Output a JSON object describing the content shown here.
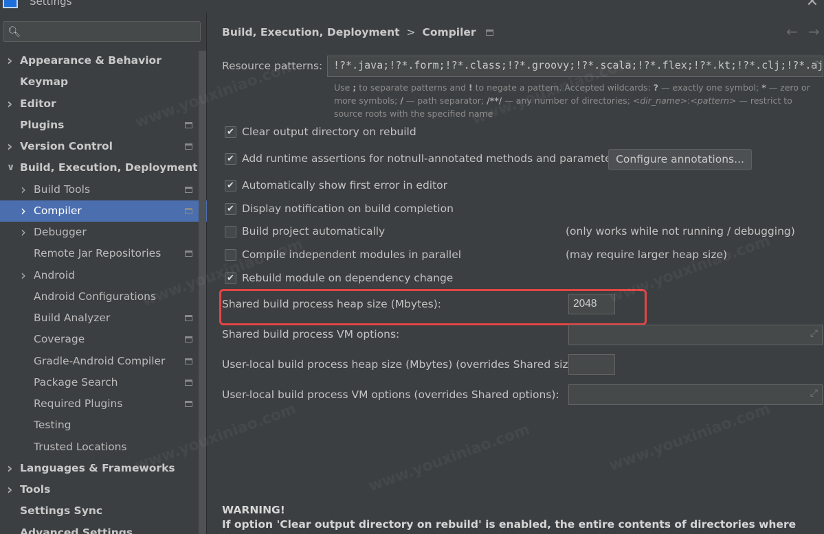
{
  "window": {
    "title": "Settings"
  },
  "sidebar": {
    "search_placeholder": "",
    "items": [
      {
        "label": "Appearance & Behavior",
        "bold": true,
        "chevron": true,
        "level": 0,
        "icon": false
      },
      {
        "label": "Keymap",
        "bold": true,
        "chevron": false,
        "level": 0,
        "icon": false
      },
      {
        "label": "Editor",
        "bold": true,
        "chevron": true,
        "level": 0,
        "icon": false
      },
      {
        "label": "Plugins",
        "bold": true,
        "chevron": false,
        "level": 0,
        "icon": true
      },
      {
        "label": "Version Control",
        "bold": true,
        "chevron": true,
        "level": 0,
        "icon": true
      },
      {
        "label": "Build, Execution, Deployment",
        "bold": true,
        "chevron": true,
        "expanded": true,
        "level": 0,
        "icon": false
      },
      {
        "label": "Build Tools",
        "bold": false,
        "chevron": true,
        "level": 1,
        "icon": true
      },
      {
        "label": "Compiler",
        "bold": false,
        "chevron": true,
        "level": 1,
        "icon": true,
        "selected": true
      },
      {
        "label": "Debugger",
        "bold": false,
        "chevron": true,
        "level": 1,
        "icon": false
      },
      {
        "label": "Remote Jar Repositories",
        "bold": false,
        "chevron": false,
        "level": 1,
        "icon": true
      },
      {
        "label": "Android",
        "bold": false,
        "chevron": true,
        "level": 1,
        "icon": false
      },
      {
        "label": "Android Configurations",
        "bold": false,
        "chevron": false,
        "level": 1,
        "icon": false
      },
      {
        "label": "Build Analyzer",
        "bold": false,
        "chevron": false,
        "level": 1,
        "icon": true
      },
      {
        "label": "Coverage",
        "bold": false,
        "chevron": false,
        "level": 1,
        "icon": true
      },
      {
        "label": "Gradle-Android Compiler",
        "bold": false,
        "chevron": false,
        "level": 1,
        "icon": true
      },
      {
        "label": "Package Search",
        "bold": false,
        "chevron": false,
        "level": 1,
        "icon": true
      },
      {
        "label": "Required Plugins",
        "bold": false,
        "chevron": false,
        "level": 1,
        "icon": true
      },
      {
        "label": "Testing",
        "bold": false,
        "chevron": false,
        "level": 1,
        "icon": false
      },
      {
        "label": "Trusted Locations",
        "bold": false,
        "chevron": false,
        "level": 1,
        "icon": false
      },
      {
        "label": "Languages & Frameworks",
        "bold": true,
        "chevron": true,
        "level": 0,
        "icon": false
      },
      {
        "label": "Tools",
        "bold": true,
        "chevron": true,
        "level": 0,
        "icon": false
      },
      {
        "label": "Settings Sync",
        "bold": true,
        "chevron": false,
        "level": 0,
        "icon": false
      },
      {
        "label": "Advanced Settings",
        "bold": true,
        "chevron": false,
        "level": 0,
        "icon": false
      }
    ]
  },
  "breadcrumb": {
    "parent": "Build, Execution, Deployment",
    "separator": ">",
    "current": "Compiler"
  },
  "resource": {
    "label": "Resource patterns:",
    "value": "!?*.java;!?*.form;!?*.class;!?*.groovy;!?*.scala;!?*.flex;!?*.kt;!?*.clj;!?*.aj",
    "hint_parts": {
      "p1": "Use ",
      "b1": ";",
      "p2": " to separate patterns and ",
      "b2": "!",
      "p3": " to negate a pattern. Accepted wildcards: ",
      "b3": "?",
      "p4": " — exactly one symbol; ",
      "b4": "*",
      "p5": " — zero or more symbols; ",
      "b5": "/",
      "p6": " — path separator; ",
      "b6": "/**/",
      "p7": " — any number of directories; ",
      "i1": "<dir_name>",
      "p8": ":",
      "i2": "<pattern>",
      "p9": " — restrict to source roots with the specified name"
    }
  },
  "options": [
    {
      "label": "Clear output directory on rebuild",
      "checked": true
    },
    {
      "label": "Add runtime assertions for notnull-annotated methods and parameters",
      "checked": true
    },
    {
      "label": "Automatically show first error in editor",
      "checked": true
    },
    {
      "label": "Display notification on build completion",
      "checked": true
    },
    {
      "label": "Build project automatically",
      "checked": false
    },
    {
      "label": "Compile independent modules in parallel",
      "checked": false
    },
    {
      "label": "Rebuild module on dependency change",
      "checked": true
    }
  ],
  "notes": {
    "auto_build": "(only works while not running / debugging)",
    "parallel": "(may require larger heap size)"
  },
  "configure_button": "Configure annotations...",
  "fields": {
    "heap_label": "Shared build process heap size (Mbytes):",
    "heap_value": "2048",
    "vm_label": "Shared build process VM options:",
    "user_heap_label": "User-local build process heap size (Mbytes) (overrides Shared size):",
    "user_vm_label": "User-local build process VM options (overrides Shared options):"
  },
  "warning": {
    "title": "WARNING!",
    "text": "If option 'Clear output directory on rebuild' is enabled, the entire contents of directories where generated sources are stored WILL BE CLEARED on rebuild."
  },
  "watermark": "www.youxiniao.com",
  "colors": {
    "selection": "#4b6eaf",
    "highlight": "#e54545",
    "background": "#3c3f41"
  }
}
